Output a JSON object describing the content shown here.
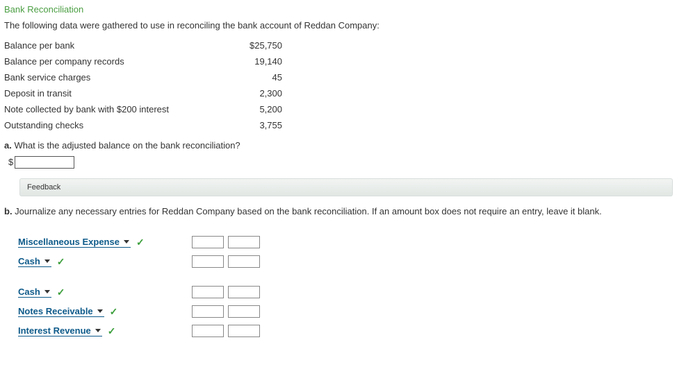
{
  "title": "Bank Reconciliation",
  "intro": "The following data were gathered to use in reconciling the bank account of Reddan Company:",
  "rows": [
    {
      "label": "Balance per bank",
      "value": "$25,750"
    },
    {
      "label": "Balance per company records",
      "value": "19,140"
    },
    {
      "label": "Bank service charges",
      "value": "45"
    },
    {
      "label": "Deposit in transit",
      "value": "2,300"
    },
    {
      "label": "Note collected by bank with $200 interest",
      "value": "5,200"
    },
    {
      "label": "Outstanding checks",
      "value": "3,755"
    }
  ],
  "qa": {
    "letter": "a.",
    "text": " What is the adjusted balance on the bank reconciliation?",
    "dollar": "$"
  },
  "feedback": "Feedback",
  "qb": {
    "letter": "b.",
    "text": " Journalize any necessary entries for Reddan Company based on the bank reconciliation. If an amount box does not require an entry, leave it blank."
  },
  "journal": {
    "group1": [
      {
        "acct": "Miscellaneous Expense"
      },
      {
        "acct": "Cash"
      }
    ],
    "group2": [
      {
        "acct": "Cash"
      },
      {
        "acct": "Notes Receivable"
      },
      {
        "acct": "Interest Revenue"
      }
    ]
  }
}
